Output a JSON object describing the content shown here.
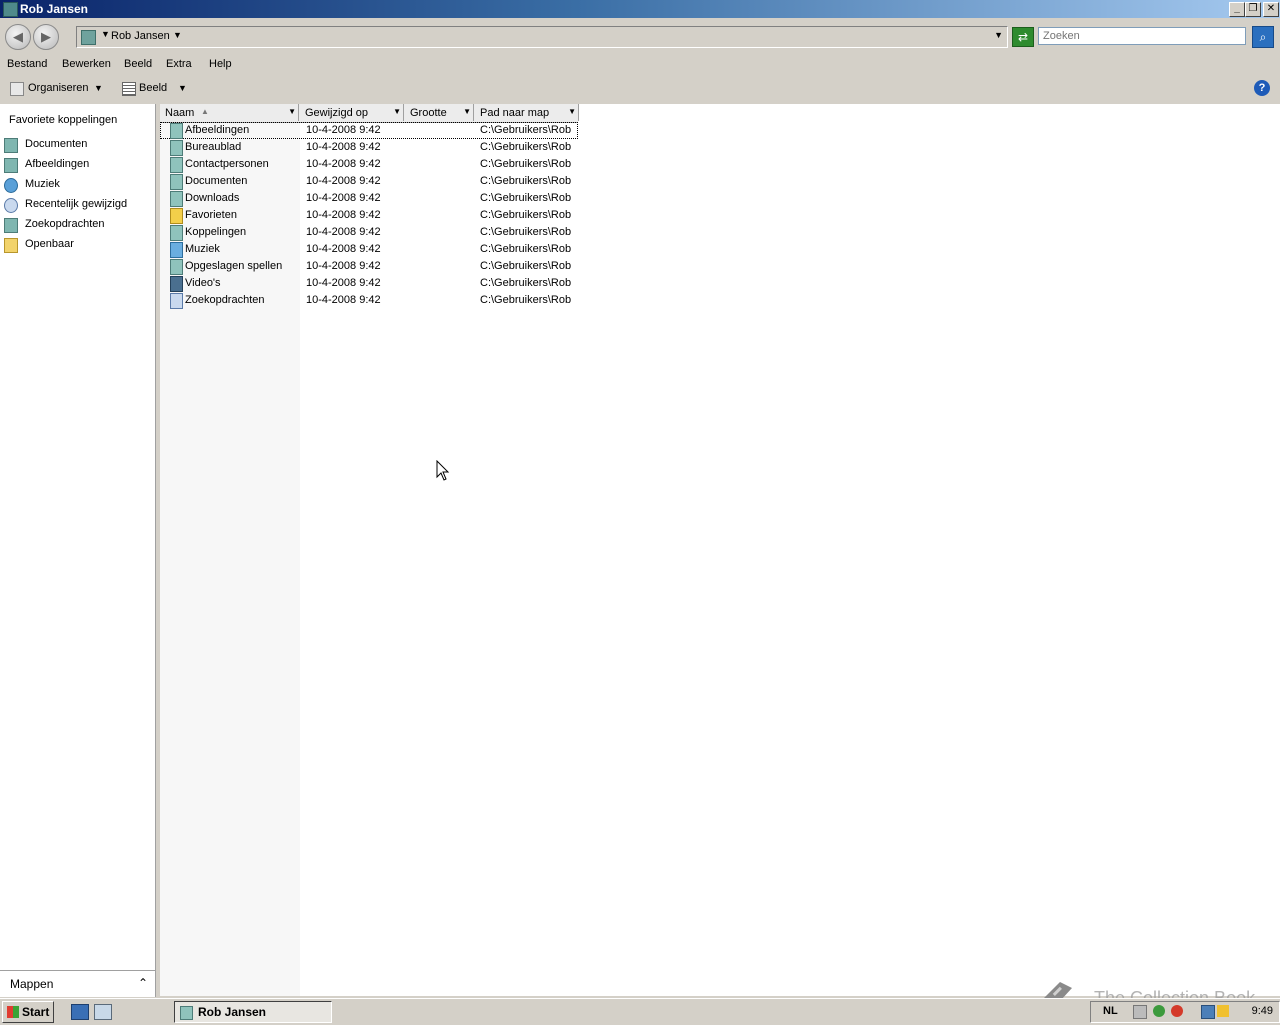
{
  "window": {
    "title": "Rob Jansen"
  },
  "address": {
    "crumb": "Rob Jansen",
    "search_placeholder": "Zoeken"
  },
  "menu": [
    "Bestand",
    "Bewerken",
    "Beeld",
    "Extra",
    "Help"
  ],
  "toolbar": {
    "organize": "Organiseren",
    "view": "Beeld"
  },
  "left_nav": {
    "title": "Favoriete koppelingen",
    "items": [
      {
        "label": "Documenten",
        "icon": "documents-icon"
      },
      {
        "label": "Afbeeldingen",
        "icon": "pictures-icon"
      },
      {
        "label": "Muziek",
        "icon": "music-icon"
      },
      {
        "label": "Recentelijk gewijzigd",
        "icon": "recent-icon"
      },
      {
        "label": "Zoekopdrachten",
        "icon": "searches-icon"
      },
      {
        "label": "Openbaar",
        "icon": "public-folder-icon"
      }
    ],
    "folders_label": "Mappen"
  },
  "columns": {
    "name": "Naam",
    "modified": "Gewijzigd op",
    "size": "Grootte",
    "path": "Pad naar map"
  },
  "files": [
    {
      "name": "Afbeeldingen",
      "modified": "10-4-2008 9:42",
      "path": "C:\\Gebruikers\\Rob"
    },
    {
      "name": "Bureaublad",
      "modified": "10-4-2008 9:42",
      "path": "C:\\Gebruikers\\Rob"
    },
    {
      "name": "Contactpersonen",
      "modified": "10-4-2008 9:42",
      "path": "C:\\Gebruikers\\Rob"
    },
    {
      "name": "Documenten",
      "modified": "10-4-2008 9:42",
      "path": "C:\\Gebruikers\\Rob"
    },
    {
      "name": "Downloads",
      "modified": "10-4-2008 9:42",
      "path": "C:\\Gebruikers\\Rob"
    },
    {
      "name": "Favorieten",
      "modified": "10-4-2008 9:42",
      "path": "C:\\Gebruikers\\Rob"
    },
    {
      "name": "Koppelingen",
      "modified": "10-4-2008 9:42",
      "path": "C:\\Gebruikers\\Rob"
    },
    {
      "name": "Muziek",
      "modified": "10-4-2008 9:42",
      "path": "C:\\Gebruikers\\Rob"
    },
    {
      "name": "Opgeslagen spellen",
      "modified": "10-4-2008 9:42",
      "path": "C:\\Gebruikers\\Rob"
    },
    {
      "name": "Video's",
      "modified": "10-4-2008 9:42",
      "path": "C:\\Gebruikers\\Rob"
    },
    {
      "name": "Zoekopdrachten",
      "modified": "10-4-2008 9:42",
      "path": "C:\\Gebruikers\\Rob"
    }
  ],
  "taskbar": {
    "start": "Start",
    "task": "Rob Jansen",
    "language": "NL",
    "clock": "9:49"
  },
  "watermark": "The Collection Book"
}
